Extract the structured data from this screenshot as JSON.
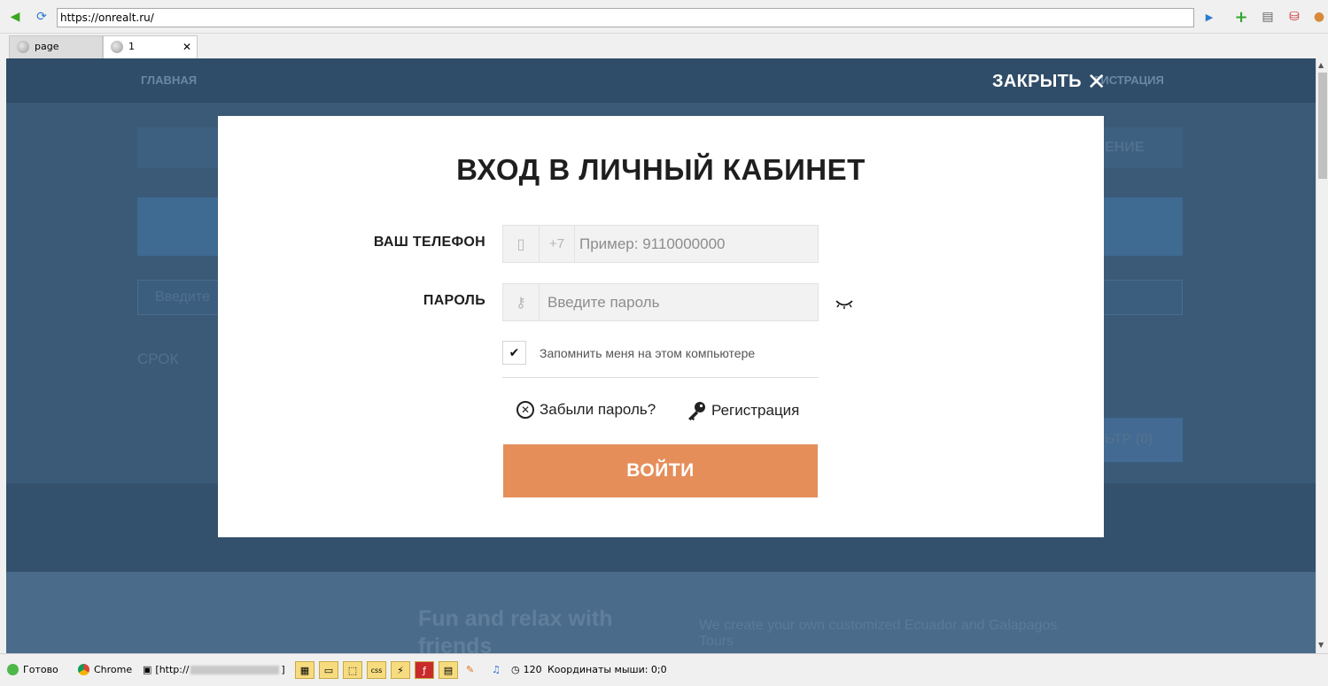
{
  "browser": {
    "url": "https://onrealt.ru/",
    "tabs": [
      {
        "label": "page"
      },
      {
        "label": "1",
        "close": "✕"
      }
    ]
  },
  "background_page": {
    "nav_left": "ГЛАВНАЯ",
    "nav_right": "ГИСТРАЦИЯ",
    "right_tab": "ЕНИЕ",
    "srok": "СРОК",
    "filter_btn": "ЬТР (0)",
    "hint1": "Введите",
    "promo_title": "Fun and relax with friends",
    "promo_text": "We create your own customized Ecuador and Galapagos Tours"
  },
  "modal": {
    "close_label": "ЗАКРЫТЬ",
    "title": "ВХОД В ЛИЧНЫЙ КАБИНЕТ",
    "phone_label": "ВАШ ТЕЛЕФОН",
    "phone_prefix": "+7",
    "phone_placeholder": "Пример: 9110000000",
    "password_label": "ПАРОЛЬ",
    "password_placeholder": "Введите пароль",
    "remember_label": "Запомнить меня на этом компьютере",
    "remember_checked": true,
    "forgot_label": "Забыли пароль?",
    "register_label": "Регистрация",
    "login_button": "ВОЙТИ",
    "accent_color": "#e58e5a"
  },
  "statusbar": {
    "ready": "Готово",
    "browser": "Chrome",
    "proxy_prefix": "[http://",
    "proxy_suffix": "]",
    "threads": "120",
    "mouse": "Координаты мыши: 0;0"
  }
}
